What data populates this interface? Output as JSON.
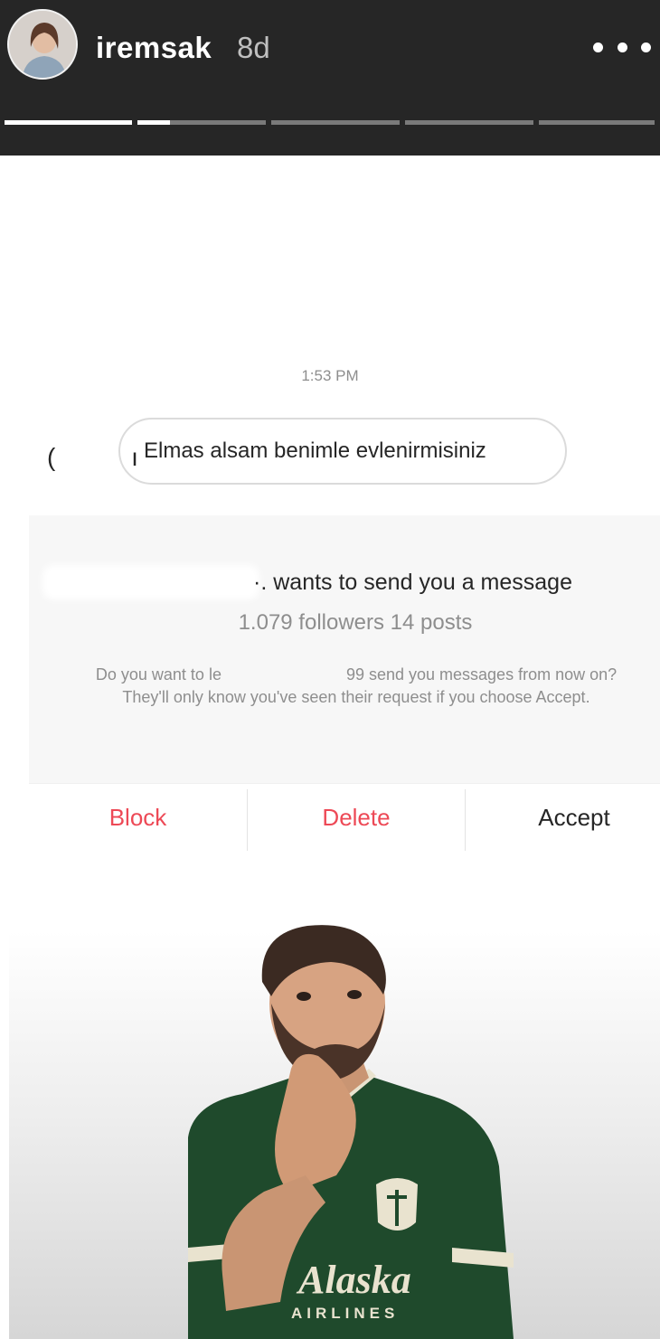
{
  "story_header": {
    "username": "iremsak",
    "time_ago": "8d",
    "progress_segments": [
      1.0,
      0.25,
      0,
      0,
      0
    ]
  },
  "message": {
    "timestamp": "1:53 PM",
    "avatar_fragment": "( ı",
    "text": "Elmas alsam benimle evlenirmisiniz"
  },
  "request": {
    "sender_fragment": "·.",
    "wants_text": "wants to send you a message",
    "stats": "1.079 followers 14 posts",
    "explanation_part1": "Do you want to le",
    "explanation_part2": "99 send you messages from now on? They'll only know you've seen their request if you choose Accept."
  },
  "actions": {
    "block_label": "Block",
    "delete_label": "Delete",
    "accept_label": "Accept"
  },
  "colors": {
    "header_bg": "#262626",
    "destructive": "#ed4956",
    "text_primary": "#262626",
    "text_secondary": "#8e8e8e",
    "jersey_green": "#1f4a2c"
  },
  "sticker": {
    "jersey_line1": "Alaska",
    "jersey_line2": "AIRLINES"
  }
}
